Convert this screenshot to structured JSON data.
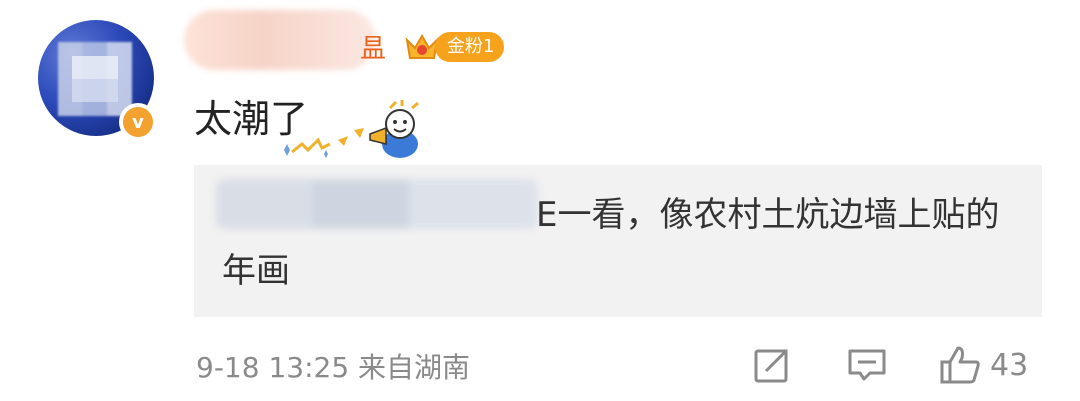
{
  "comment": {
    "user": {
      "name_visible": "昷",
      "badge": "金粉1",
      "verified": true
    },
    "text": "太潮了",
    "sticker": "emoji-sticker",
    "reply_quote": "E一看，像农村土炕边墙上贴的年画",
    "meta": "9-18 13:25 来自湖南",
    "actions": {
      "share_icon": "share-icon",
      "comment_icon": "comment-icon",
      "like_icon": "like-icon",
      "like_count": "43"
    },
    "colors": {
      "badge_orange": "#f7a21c",
      "verify_orange": "#f3a22f",
      "name_orange": "#e8621b",
      "meta_gray": "#8a8a8a",
      "quote_bg": "#f2f2f2"
    }
  }
}
